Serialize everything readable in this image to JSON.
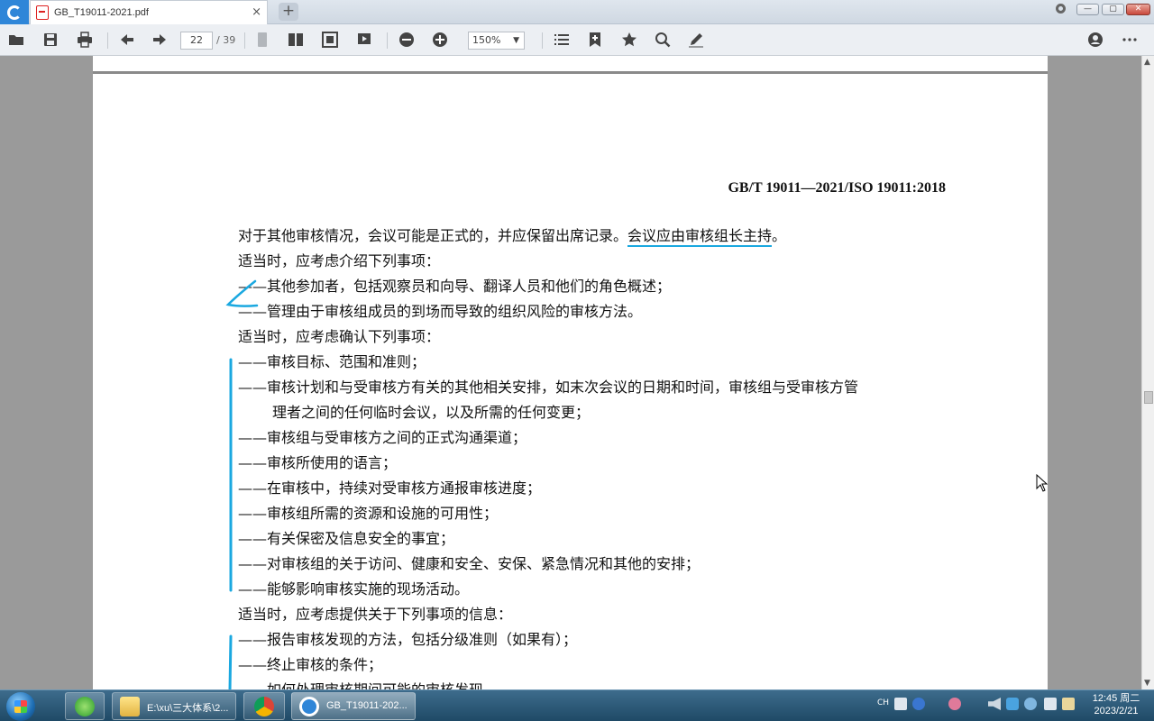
{
  "tab": {
    "title": "GB_T19011-2021.pdf",
    "close": "×",
    "new": "+"
  },
  "window": {
    "min": "—",
    "max": "▢",
    "close": "✕"
  },
  "toolbar": {
    "page_current": "22",
    "page_total": "/ 39",
    "zoom": "150%"
  },
  "document": {
    "header": "GB/T 19011—2021/ISO 19011:2018",
    "lines": [
      {
        "pre": "对于其他审核情况，会议可能是正式的，并应保留出席记录。",
        "underlined": "会议应由审核组长主持",
        "post": "。"
      },
      {
        "text": "适当时，应考虑介绍下列事项："
      },
      {
        "text": "——其他参加者，包括观察员和向导、翻译人员和他们的角色概述；"
      },
      {
        "text": "——管理由于审核组成员的到场而导致的组织风险的审核方法。"
      },
      {
        "text": "适当时，应考虑确认下列事项："
      },
      {
        "text": "——审核目标、范围和准则；"
      },
      {
        "text": "——审核计划和与受审核方有关的其他相关安排，如末次会议的日期和时间，审核组与受审核方管"
      },
      {
        "text": "理者之间的任何临时会议，以及所需的任何变更；"
      },
      {
        "text": "——审核组与受审核方之间的正式沟通渠道；"
      },
      {
        "text": "——审核所使用的语言；"
      },
      {
        "text": "——在审核中，持续对受审核方通报审核进度；"
      },
      {
        "text": "——审核组所需的资源和设施的可用性；"
      },
      {
        "text": "——有关保密及信息安全的事宜；"
      },
      {
        "text": "——对审核组的关于访问、健康和安全、安保、紧急情况和其他的安排；"
      },
      {
        "text": "——能够影响审核实施的现场活动。"
      },
      {
        "text": "适当时，应考虑提供关于下列事项的信息："
      },
      {
        "text": "——报告审核发现的方法，包括分级准则（如果有）；"
      },
      {
        "text": "——终止审核的条件；"
      },
      {
        "text": "——如何处理审核期间可能的审核发现"
      }
    ]
  },
  "taskbar": {
    "explorer_label": "E:\\xu\\三大体系\\2...",
    "reader_label": "GB_T19011-202...",
    "lang": "CH",
    "time": "12:45 周二",
    "date": "2023/2/21"
  },
  "colors": {
    "annotation": "#1aa8e0",
    "accent": "#2f86d8"
  }
}
